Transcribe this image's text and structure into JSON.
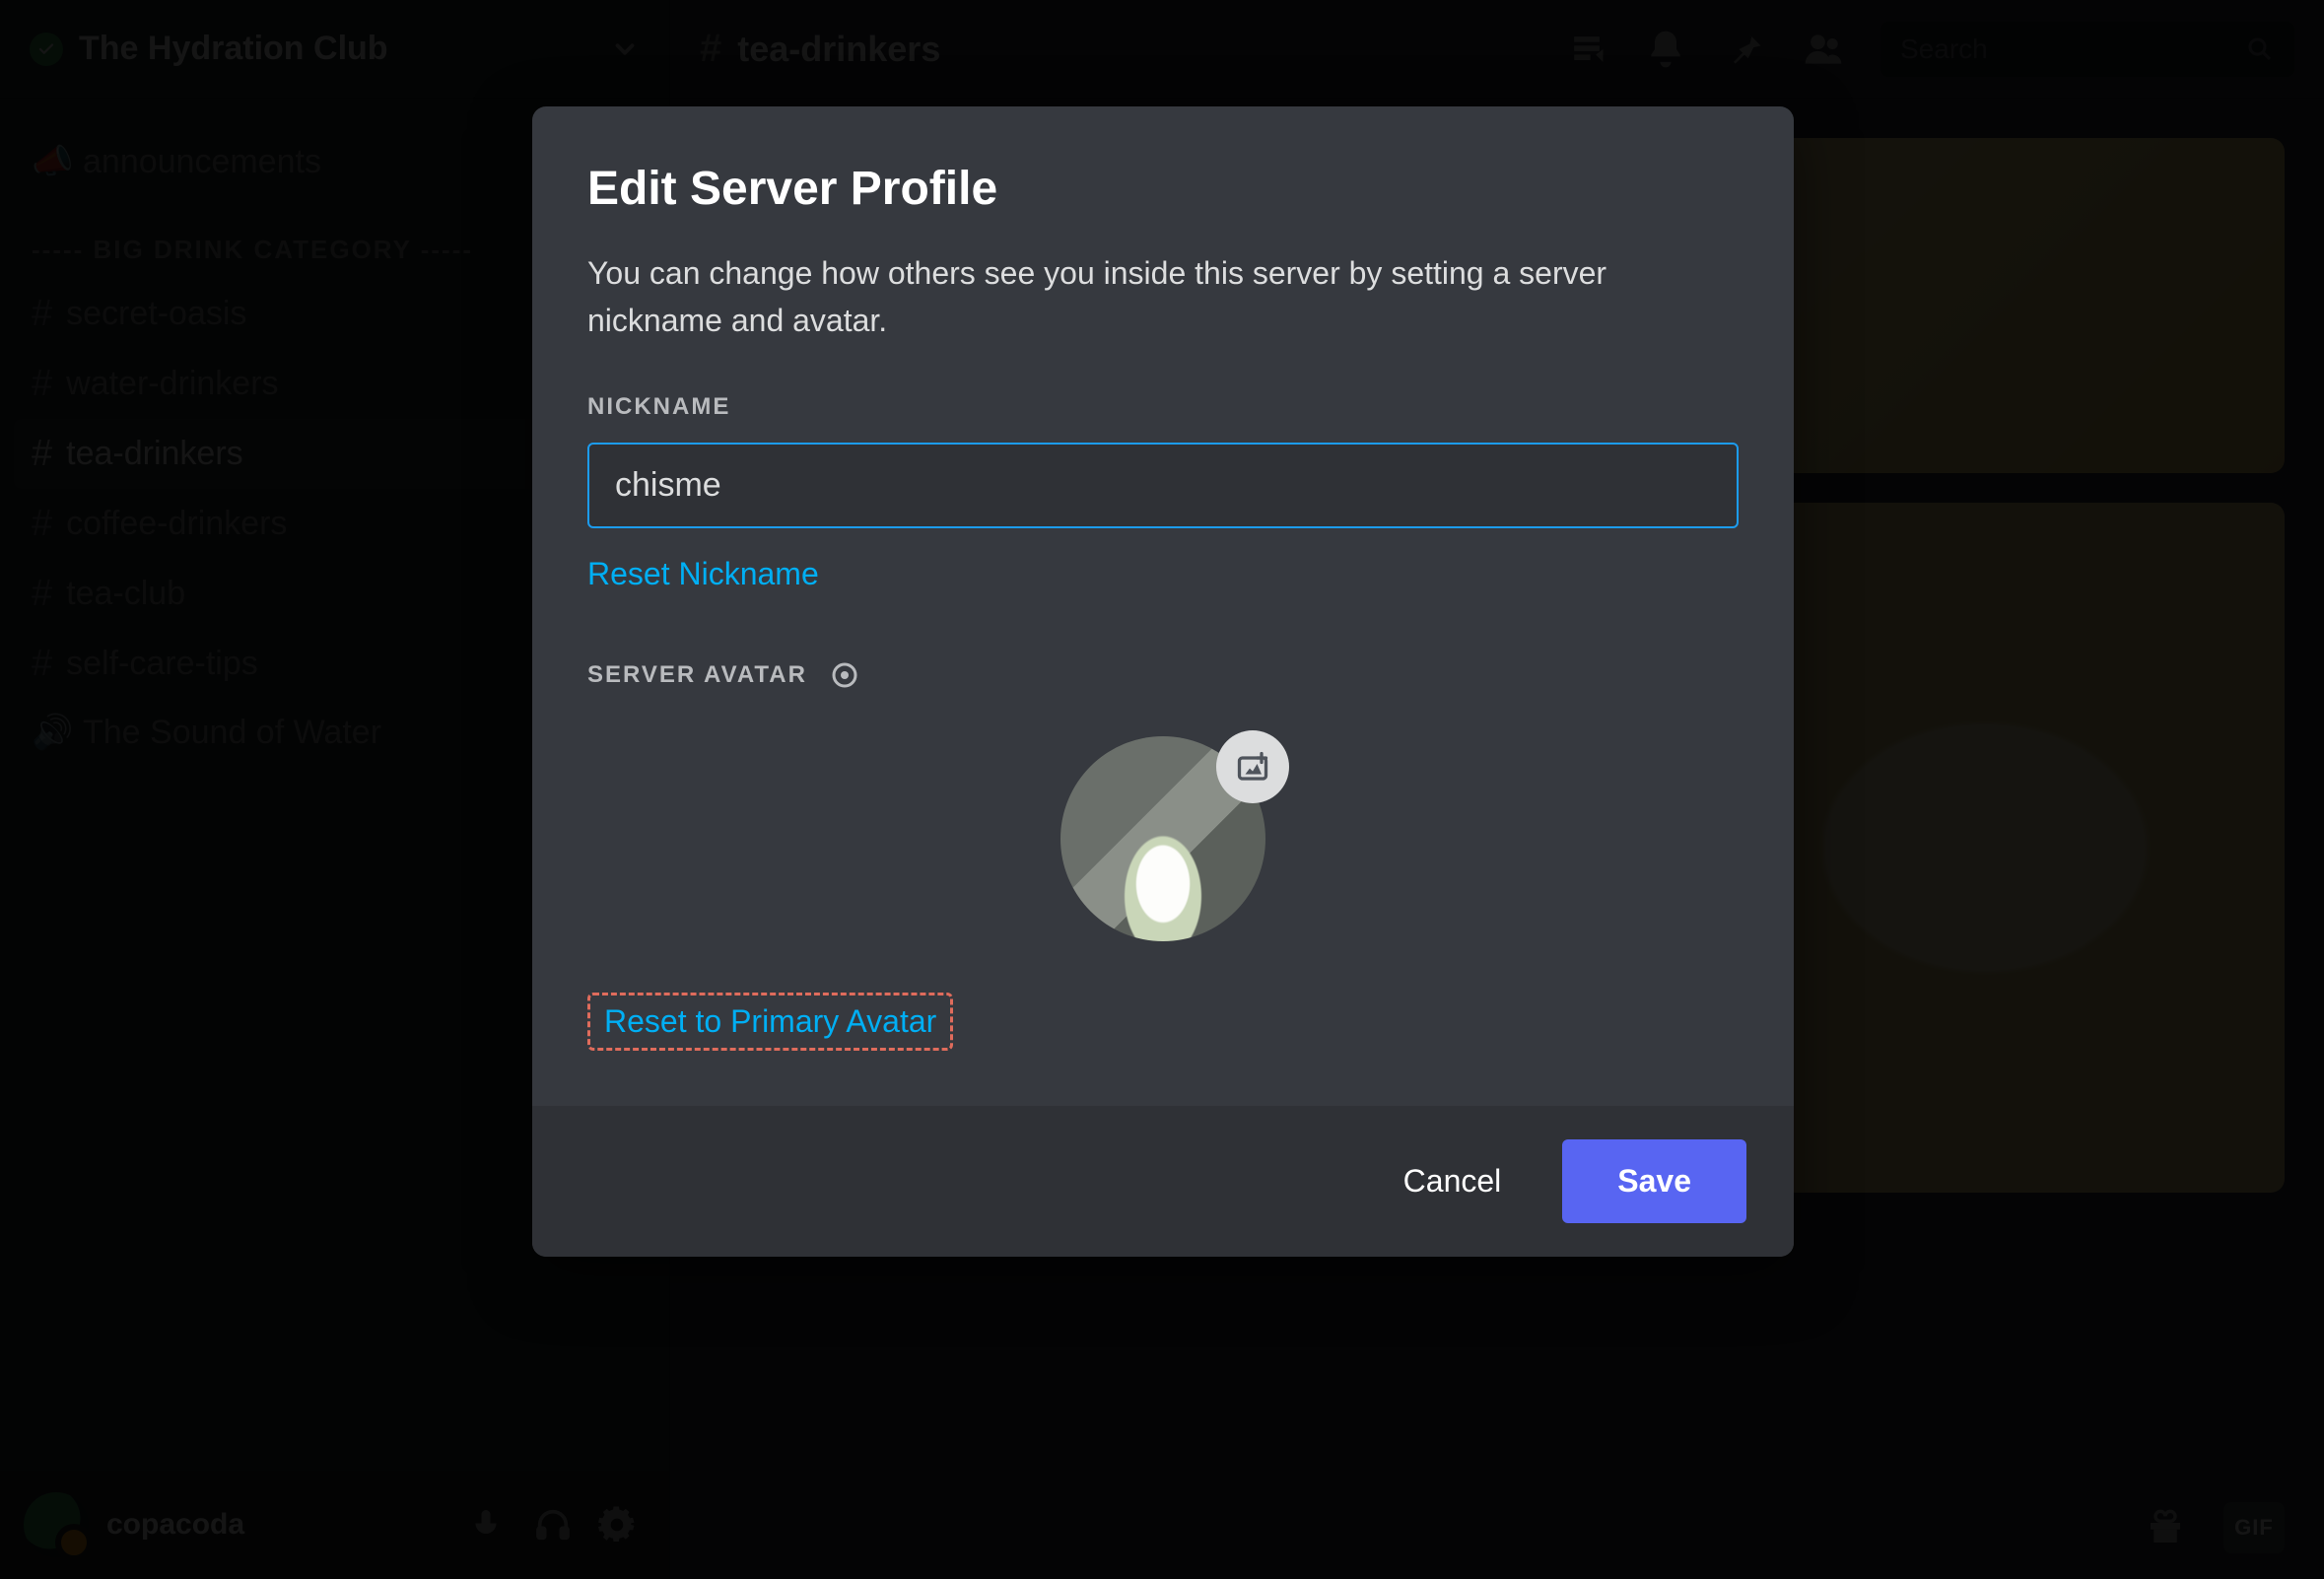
{
  "server": {
    "name": "The Hydration Club",
    "verified": true
  },
  "sidebar": {
    "announcements_label": "announcements",
    "category_label": "----- BIG DRINK CATEGORY -----",
    "channels": [
      {
        "name": "secret-oasis",
        "locked": true
      },
      {
        "name": "water-drinkers",
        "locked": true
      },
      {
        "name": "tea-drinkers",
        "locked": false,
        "active": true
      },
      {
        "name": "coffee-drinkers",
        "locked": true
      },
      {
        "name": "tea-club",
        "locked": false
      },
      {
        "name": "self-care-tips",
        "locked": false
      }
    ],
    "voice_channel": "The Sound of Water"
  },
  "user_panel": {
    "username": "copacoda"
  },
  "topbar": {
    "channel": "tea-drinkers",
    "search_placeholder": "Search"
  },
  "bottom": {
    "gif_label": "GIF"
  },
  "modal": {
    "title": "Edit Server Profile",
    "description": "You can change how others see you inside this server by setting a server nickname and avatar.",
    "nickname_label": "Nickname",
    "nickname_value": "chisme",
    "reset_nickname": "Reset Nickname",
    "server_avatar_label": "Server Avatar",
    "reset_avatar": "Reset to Primary Avatar",
    "cancel": "Cancel",
    "save": "Save"
  }
}
